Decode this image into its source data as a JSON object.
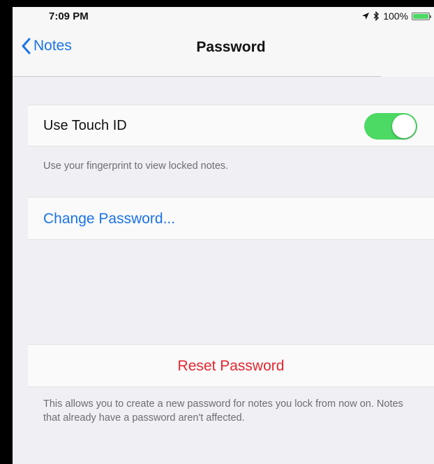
{
  "status_bar": {
    "time": "7:09 PM",
    "battery_text": "100%",
    "battery_level": 1.0,
    "icons": [
      "location-arrow-icon",
      "bluetooth-icon",
      "battery-icon"
    ]
  },
  "nav": {
    "back_label": "Notes",
    "title": "Password"
  },
  "touch_id": {
    "label": "Use Touch ID",
    "enabled": true,
    "footnote": "Use your fingerprint to view locked notes."
  },
  "change_password": {
    "label": "Change Password..."
  },
  "reset_password": {
    "label": "Reset Password",
    "footnote": "This allows you to create a new password for notes you lock from now on. Notes that already have a password aren't affected."
  },
  "colors": {
    "accent": "#1a73e8",
    "destructive": "#e4262d",
    "toggle_on": "#4cd964",
    "background": "#efeff4"
  }
}
